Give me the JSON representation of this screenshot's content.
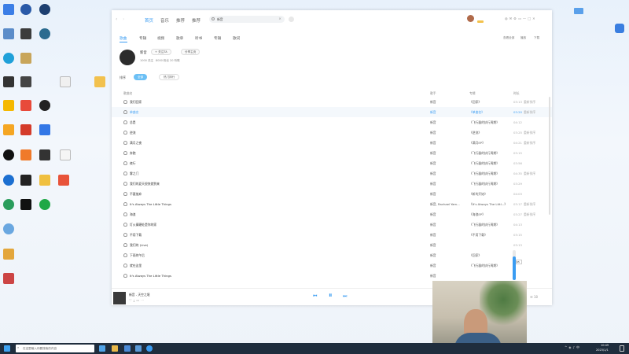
{
  "colors": {
    "accent": "#3a9cf2",
    "tag": "#e8b04a",
    "taskbar": "#1f2d3d"
  },
  "player": {
    "nav": {
      "tabs": [
        "首页",
        "音乐",
        "推荐",
        "推荐"
      ],
      "search_value": "新音"
    },
    "profile": {
      "name": "新音",
      "btn_follow": "+ 关注TA",
      "btn_share": "分享主页",
      "stats": [
        "1000 关注",
        "8000 粉丝",
        "20 听歌"
      ]
    },
    "subtabs": [
      "歌曲",
      "专辑",
      "视频",
      "歌单",
      "听书",
      "专辑",
      "歌词"
    ],
    "subtabs_right": [
      "查看全部",
      "播放",
      "下载"
    ],
    "filter": {
      "label": "排序",
      "btn_active": "全部",
      "btn_other": "热门排行"
    },
    "table_headers": {
      "title": "歌曲名",
      "artist": "歌手",
      "album": "专辑",
      "dur": "时长"
    },
    "songs": [
      {
        "title": "我们回家",
        "artist": "新音",
        "album": "《回家》",
        "dur": "03:13",
        "ops": "重新排序"
      },
      {
        "title": "单曲名",
        "artist": "新音",
        "album": "《单曲名》",
        "dur": "03:20",
        "ops": "重新排序"
      },
      {
        "title": "总是",
        "artist": "新音",
        "album": "《飞行器的执行周期》",
        "dur": "04:12",
        "ops": ""
      },
      {
        "title": "逆流",
        "artist": "新音",
        "album": "《逆流》",
        "dur": "03:25",
        "ops": "重新排序"
      },
      {
        "title": "满月之夜",
        "artist": "新音",
        "album": "《满月EP》",
        "dur": "04:21",
        "ops": "重新排序"
      },
      {
        "title": "奔跑",
        "artist": "新音",
        "album": "《飞行器的执行周期》",
        "dur": "03:15",
        "ops": ""
      },
      {
        "title": "夜行",
        "artist": "新音",
        "album": "《飞行器的执行周期》",
        "dur": "03:56",
        "ops": ""
      },
      {
        "title": "雾之门",
        "artist": "新音",
        "album": "《飞行器的执行周期》",
        "dur": "04:35",
        "ops": "重新排序"
      },
      {
        "title": "我们的夏天很快就到来",
        "artist": "新音",
        "album": "《飞行器的执行周期》",
        "dur": "03:29",
        "ops": ""
      },
      {
        "title": "不要放弃",
        "artist": "新音",
        "album": "《新的开始》",
        "dur": "04:03",
        "ops": ""
      },
      {
        "title": "It's Always The Little Things",
        "artist": "新音, Rachael Yam...",
        "album": "《It's Always The Littl...》",
        "dur": "03:17",
        "ops": "重新排序"
      },
      {
        "title": "海浪",
        "artist": "新音",
        "album": "《海浪EP》",
        "dur": "03:27",
        "ops": "重新排序"
      },
      {
        "title": "灯火阑珊处是你的家",
        "artist": "新音",
        "album": "《飞行器的执行周期》",
        "dur": "04:13",
        "ops": ""
      },
      {
        "title": "不用下载",
        "artist": "新音",
        "album": "《不用下载》",
        "dur": "03:15",
        "ops": ""
      },
      {
        "title": "我们的 (Live)",
        "artist": "新音",
        "album": "",
        "dur": "03:13",
        "ops": ""
      },
      {
        "title": "下雨的午后",
        "artist": "新音",
        "album": "《回家》",
        "dur": "",
        "ops": ""
      },
      {
        "title": "就在这里",
        "artist": "新音",
        "album": "《飞行器的执行周期》",
        "dur": "",
        "ops": ""
      },
      {
        "title": "It's Always The Little Things",
        "artist": "新音",
        "album": "",
        "dur": "",
        "ops": ""
      }
    ],
    "footer": {
      "now_title": "新音 - 天空之境",
      "time": "01:45 / 03:50"
    }
  },
  "taskbar": {
    "search_placeholder": "在这里输入你要搜索的内容",
    "clock": "10:49",
    "date": "2023/1/1"
  },
  "icons": [
    "search-icon",
    "heart-icon",
    "play-icon",
    "pause-icon",
    "prev-icon",
    "next-icon",
    "volume-icon",
    "windows-icon",
    "close-icon"
  ]
}
